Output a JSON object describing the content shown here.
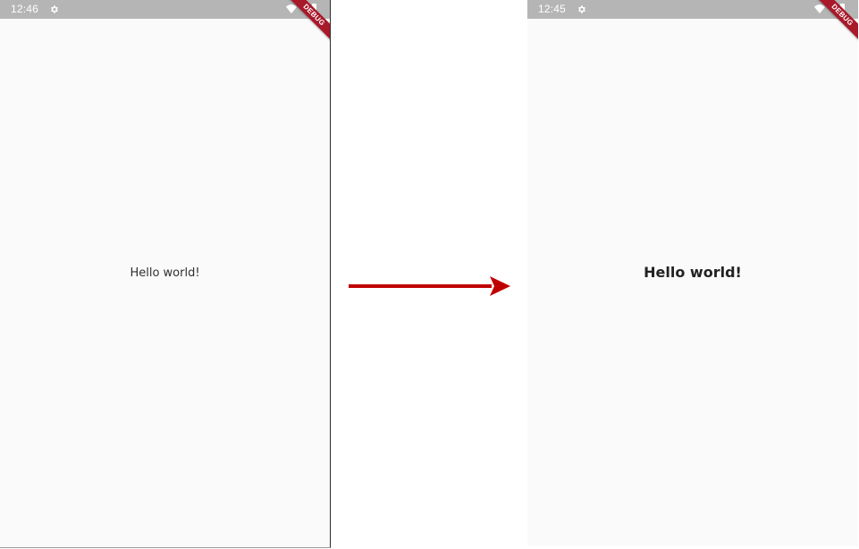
{
  "left_screen": {
    "status_time": "12:46",
    "icons": [
      "gear-icon",
      "wifi-icon",
      "battery-icon"
    ],
    "debug_label": "DEBUG",
    "body_text": "Hello world!"
  },
  "right_screen": {
    "status_time": "12:45",
    "icons": [
      "gear-icon",
      "wifi-icon",
      "battery-icon"
    ],
    "debug_label": "DEBUG",
    "body_text": "Hello world!"
  },
  "colors": {
    "status_bar": "#b5b5b5",
    "screen_background": "#fafafa",
    "debug_ribbon": "#a8192a",
    "arrow": "#c00000"
  }
}
